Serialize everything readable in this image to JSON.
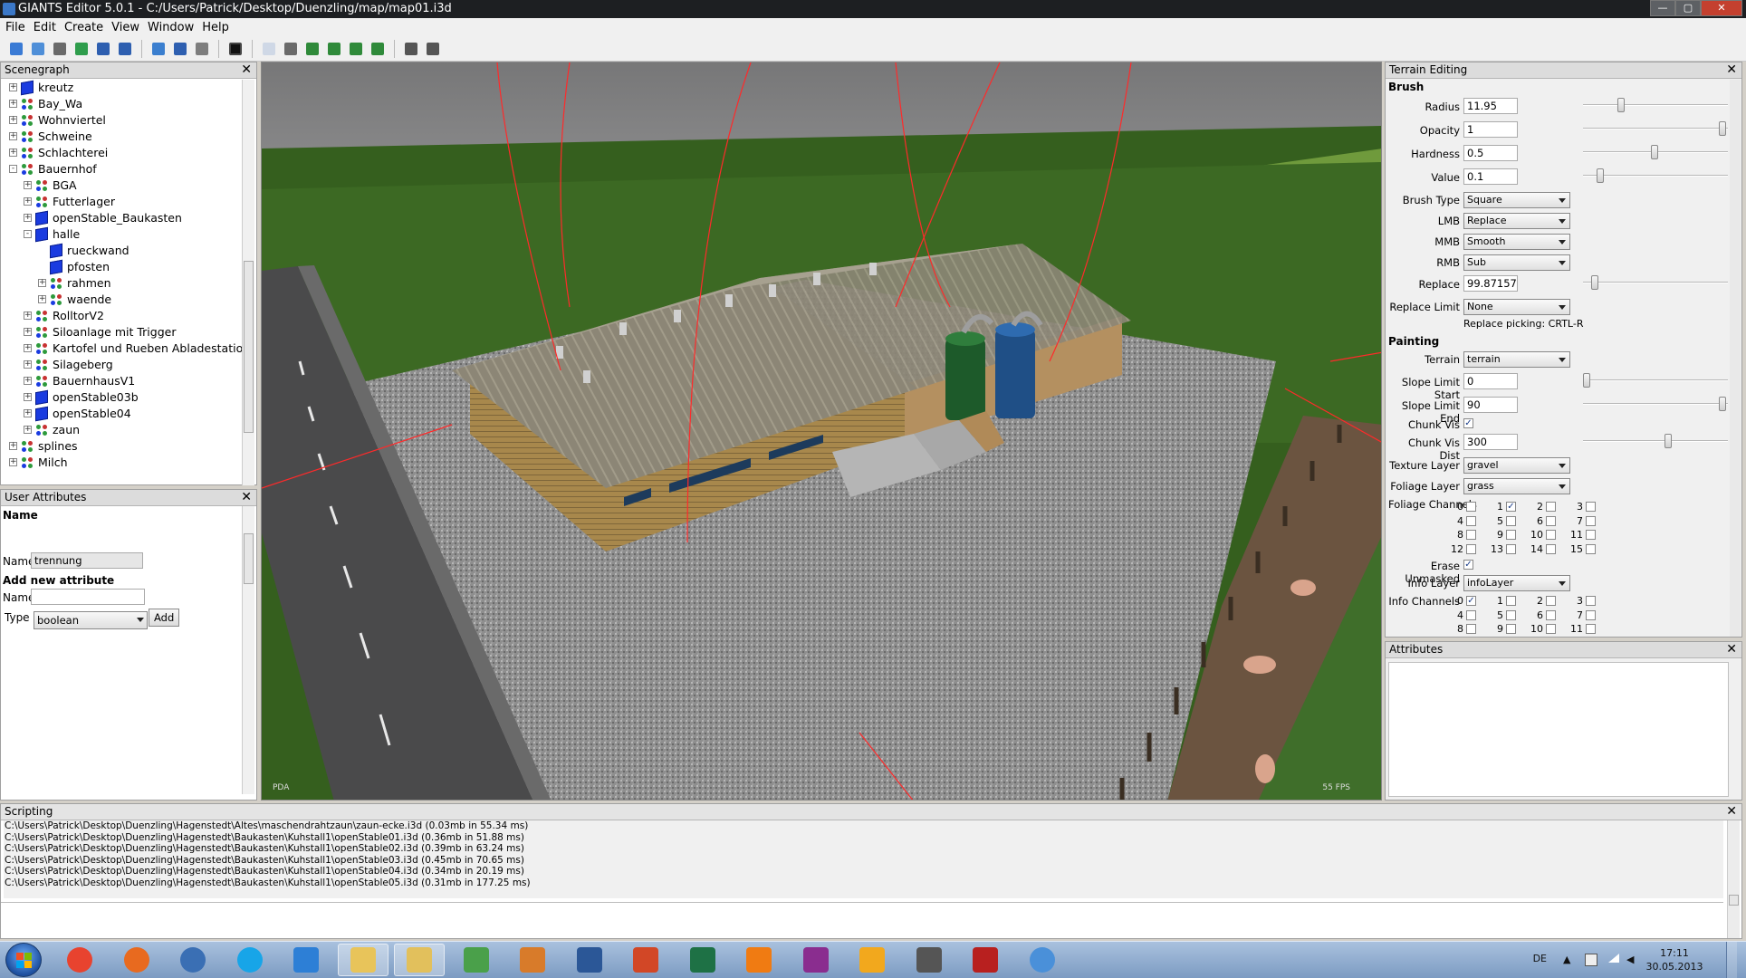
{
  "window": {
    "title": "GIANTS Editor 5.0.1 - C:/Users/Patrick/Desktop/Duenzling/map/map01.i3d"
  },
  "menu": [
    "File",
    "Edit",
    "Create",
    "View",
    "Window",
    "Help"
  ],
  "toolbar": {
    "icons": [
      "new-icon",
      "open-icon",
      "properties-icon",
      "refresh-icon",
      "save-icon",
      "save-as-icon",
      "reload-icon",
      "undo-icon",
      "redo-icon",
      "stop-icon",
      "select-mode-icon",
      "move-mode-icon",
      "terrain-sculpt-icon",
      "terrain-paint-icon",
      "terrain-smooth-icon",
      "foliage-paint-icon",
      "settings-icon",
      "spline-icon"
    ]
  },
  "scenegraph": {
    "title": "Scenegraph",
    "nodes": [
      {
        "label": "kreutz",
        "depth": 0,
        "icon": "mesh",
        "expander": "+"
      },
      {
        "label": "Bay_Wa",
        "depth": 0,
        "icon": "group",
        "expander": "+"
      },
      {
        "label": "Wohnviertel",
        "depth": 0,
        "icon": "group",
        "expander": "+"
      },
      {
        "label": "Schweine",
        "depth": 0,
        "icon": "group",
        "expander": "+"
      },
      {
        "label": "Schlachterei",
        "depth": 0,
        "icon": "group",
        "expander": "+"
      },
      {
        "label": "Bauernhof",
        "depth": 0,
        "icon": "group",
        "expander": "-"
      },
      {
        "label": "BGA",
        "depth": 1,
        "icon": "group",
        "expander": "+"
      },
      {
        "label": "Futterlager",
        "depth": 1,
        "icon": "group",
        "expander": "+"
      },
      {
        "label": "openStable_Baukasten",
        "depth": 1,
        "icon": "mesh",
        "expander": "+"
      },
      {
        "label": "halle",
        "depth": 1,
        "icon": "mesh",
        "expander": "-"
      },
      {
        "label": "rueckwand",
        "depth": 2,
        "icon": "mesh",
        "expander": ""
      },
      {
        "label": "pfosten",
        "depth": 2,
        "icon": "mesh",
        "expander": ""
      },
      {
        "label": "rahmen",
        "depth": 2,
        "icon": "group",
        "expander": "+"
      },
      {
        "label": "waende",
        "depth": 2,
        "icon": "group",
        "expander": "+"
      },
      {
        "label": "RolltorV2",
        "depth": 1,
        "icon": "group",
        "expander": "+"
      },
      {
        "label": "Siloanlage mit Trigger",
        "depth": 1,
        "icon": "group",
        "expander": "+"
      },
      {
        "label": "Kartofel und Rueben Abladestation",
        "depth": 1,
        "icon": "group",
        "expander": "+"
      },
      {
        "label": "Silageberg",
        "depth": 1,
        "icon": "group",
        "expander": "+"
      },
      {
        "label": "BauernhausV1",
        "depth": 1,
        "icon": "group",
        "expander": "+"
      },
      {
        "label": "openStable03b",
        "depth": 1,
        "icon": "mesh",
        "expander": "+"
      },
      {
        "label": "openStable04",
        "depth": 1,
        "icon": "mesh",
        "expander": "+"
      },
      {
        "label": "zaun",
        "depth": 1,
        "icon": "group",
        "expander": "+"
      },
      {
        "label": "splines",
        "depth": 0,
        "icon": "group",
        "expander": "+"
      },
      {
        "label": "Milch",
        "depth": 0,
        "icon": "group",
        "expander": "+"
      }
    ]
  },
  "user_attributes": {
    "title": "User Attributes",
    "name_heading": "Name",
    "name_label": "Name",
    "name_value": "trennung",
    "add_heading": "Add new attribute",
    "new_name_label": "Name",
    "new_name_value": "",
    "type_label": "Type",
    "type_value": "boolean",
    "add_button": "Add"
  },
  "viewport": {
    "camera_label": "PDA",
    "fps_label": "55 FPS"
  },
  "terrain_editing": {
    "title": "Terrain Editing",
    "brush_heading": "Brush",
    "radius_label": "Radius",
    "radius": "11.95",
    "radius_level": 0.25,
    "opacity_label": "Opacity",
    "opacity": "1",
    "opacity_level": 1.0,
    "hardness_label": "Hardness",
    "hardness": "0.5",
    "hardness_level": 0.5,
    "value_label": "Value",
    "value": "0.1",
    "value_level": 0.1,
    "brush_type_label": "Brush Type",
    "brush_type": "Square",
    "lmb_label": "LMB",
    "lmb": "Replace",
    "mmb_label": "MMB",
    "mmb": "Smooth",
    "rmb_label": "RMB",
    "rmb": "Sub",
    "replace_label": "Replace",
    "replace": "99.87157",
    "replace_level": 0.06,
    "replace_limit_label": "Replace Limit",
    "replace_limit": "None",
    "replace_picking": "Replace picking: CRTL-R",
    "painting_heading": "Painting",
    "terrain_label": "Terrain",
    "terrain": "terrain",
    "slope_start_label": "Slope Limit Start",
    "slope_start": "0",
    "slope_start_level": 0.0,
    "slope_end_label": "Slope Limit End",
    "slope_end": "90",
    "slope_end_level": 1.0,
    "chunk_vis_label": "Chunk Vis",
    "chunk_vis": true,
    "chunk_dist_label": "Chunk Vis Dist",
    "chunk_dist": "300",
    "chunk_dist_level": 0.6,
    "texture_layer_label": "Texture Layer",
    "texture_layer": "gravel",
    "foliage_layer_label": "Foliage Layer",
    "foliage_layer": "grass",
    "foliage_channels_label": "Foliage Channels",
    "foliage_channels_checked": [
      1
    ],
    "erase_unmasked_label": "Erase Unmasked",
    "erase_unmasked": true,
    "info_layer_label": "Info Layer",
    "info_layer": "infoLayer",
    "info_channels_label": "Info Channels",
    "info_channels_checked": [
      0
    ],
    "channel_numbers": [
      "0",
      "1",
      "2",
      "3",
      "4",
      "5",
      "6",
      "7",
      "8",
      "9",
      "10",
      "11",
      "12",
      "13",
      "14",
      "15"
    ]
  },
  "attributes_panel": {
    "title": "Attributes"
  },
  "scripting": {
    "title": "Scripting",
    "log": [
      "C:\\Users\\Patrick\\Desktop\\Duenzling\\Hagenstedt\\Altes\\maschendrahtzaun\\zaun-ecke.i3d (0.03mb in 55.34 ms)",
      "C:\\Users\\Patrick\\Desktop\\Duenzling\\Hagenstedt\\Baukasten\\Kuhstall1\\openStable01.i3d (0.36mb in 51.88 ms)",
      "C:\\Users\\Patrick\\Desktop\\Duenzling\\Hagenstedt\\Baukasten\\Kuhstall1\\openStable02.i3d (0.39mb in 63.24 ms)",
      "C:\\Users\\Patrick\\Desktop\\Duenzling\\Hagenstedt\\Baukasten\\Kuhstall1\\openStable03.i3d (0.45mb in 70.65 ms)",
      "C:\\Users\\Patrick\\Desktop\\Duenzling\\Hagenstedt\\Baukasten\\Kuhstall1\\openStable04.i3d (0.34mb in 20.19 ms)",
      "C:\\Users\\Patrick\\Desktop\\Duenzling\\Hagenstedt\\Baukasten\\Kuhstall1\\openStable05.i3d (0.31mb in 177.25 ms)"
    ]
  },
  "taskbar": {
    "apps": [
      "chrome-icon",
      "firefox-icon",
      "thunderbird-icon",
      "skype-icon",
      "tv-app-icon",
      "explorer-icon",
      "giants-editor-icon",
      "chart-app-icon",
      "installer-icon",
      "word-icon",
      "powerpoint-icon",
      "excel-icon",
      "vlc-icon",
      "winrar-icon",
      "media-player-icon",
      "tractor-icon",
      "farming-sim-icon",
      "itunes-icon"
    ],
    "active_app": "giants-editor-icon",
    "language": "DE",
    "time": "17:11",
    "date": "30.05.2013"
  },
  "colors": {
    "title_bar": "#1d1f22",
    "panel_header": "#dcdcdc",
    "sky": "#7f7f80",
    "grass": "#3e6b24",
    "gravel": "#9a9a9a",
    "road": "#4a4a4a"
  }
}
